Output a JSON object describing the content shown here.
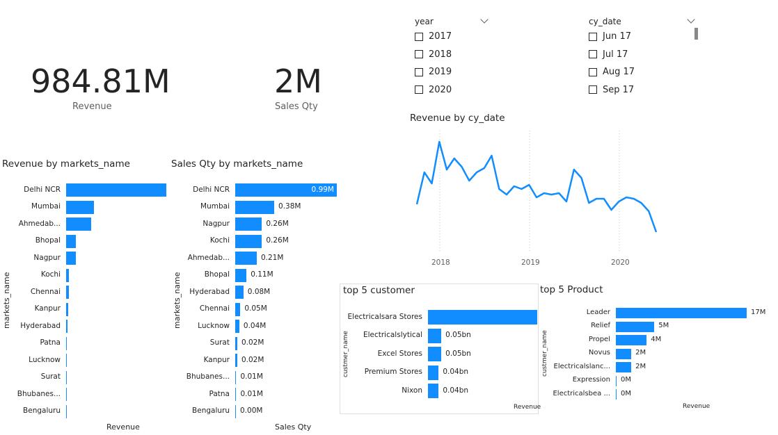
{
  "kpis": {
    "revenue": {
      "value": "984.81M",
      "label": "Revenue"
    },
    "sales_qty": {
      "value": "2M",
      "label": "Sales Qty"
    }
  },
  "slicers": {
    "year": {
      "title": "year",
      "items": [
        "2017",
        "2018",
        "2019",
        "2020"
      ]
    },
    "cy_date": {
      "title": "cy_date",
      "items": [
        "Jun 17",
        "Jul 17",
        "Aug 17",
        "Sep 17"
      ]
    }
  },
  "revenue_by_market": {
    "title": "Revenue by markets_name",
    "x_axis_title": "Revenue",
    "y_axis_title": "markets_name",
    "categories": [
      "Delhi NCR",
      "Mumbai",
      "Ahmedab...",
      "Bhopal",
      "Nagpur",
      "Kochi",
      "Chennai",
      "Kanpur",
      "Hyderabad",
      "Patna",
      "Lucknow",
      "Surat",
      "Bhubanes...",
      "Bengaluru"
    ],
    "values": [
      1.0,
      0.28,
      0.25,
      0.1,
      0.1,
      0.03,
      0.03,
      0.02,
      0.015,
      0.01,
      0.008,
      0.006,
      0.005,
      0.004
    ]
  },
  "sales_by_market": {
    "title": "Sales Qty by markets_name",
    "x_axis_title": "Sales Qty",
    "y_axis_title": "markets_name",
    "categories": [
      "Delhi NCR",
      "Mumbai",
      "Nagpur",
      "Kochi",
      "Ahmedab...",
      "Bhopal",
      "Hyderabad",
      "Chennai",
      "Lucknow",
      "Surat",
      "Kanpur",
      "Bhubanes...",
      "Patna",
      "Bengaluru"
    ],
    "values": [
      0.99,
      0.38,
      0.26,
      0.26,
      0.21,
      0.11,
      0.08,
      0.05,
      0.04,
      0.02,
      0.02,
      0.01,
      0.01,
      0.0
    ],
    "labels": [
      "0.99M",
      "0.38M",
      "0.26M",
      "0.26M",
      "0.21M",
      "0.11M",
      "0.08M",
      "0.05M",
      "0.04M",
      "0.02M",
      "0.02M",
      "0.01M",
      "0.01M",
      "0.00M"
    ]
  },
  "revenue_by_date": {
    "title": "Revenue by cy_date",
    "x_ticks": [
      "2018",
      "2019",
      "2020"
    ]
  },
  "top5_customer": {
    "title": "top 5 customer",
    "x_axis_title": "Revenue",
    "y_axis_title": "custmer_name",
    "categories": [
      "Electricalsara Stores",
      "Electricalslytical",
      "Excel Stores",
      "Premium Stores",
      "Nixon"
    ],
    "values": [
      0.41,
      0.05,
      0.05,
      0.04,
      0.04
    ],
    "labels": [
      "",
      "0.05bn",
      "0.05bn",
      "0.04bn",
      "0.04bn"
    ]
  },
  "top5_product": {
    "title": "top 5 Product",
    "x_axis_title": "Revenue",
    "y_axis_title": "custmer_name",
    "categories": [
      "Leader",
      "Relief",
      "Propel",
      "Novus",
      "Electricalslanc...",
      "Expression",
      "Electricalsbea ..."
    ],
    "values": [
      17,
      5,
      4,
      2,
      2,
      0,
      0
    ],
    "labels": [
      "17M",
      "5M",
      "4M",
      "2M",
      "2M",
      "0M",
      "0M"
    ]
  },
  "chart_data": [
    {
      "type": "bar",
      "title": "Revenue by markets_name",
      "xlabel": "Revenue",
      "ylabel": "markets_name",
      "categories": [
        "Delhi NCR",
        "Mumbai",
        "Ahmedab...",
        "Bhopal",
        "Nagpur",
        "Kochi",
        "Chennai",
        "Kanpur",
        "Hyderabad",
        "Patna",
        "Lucknow",
        "Surat",
        "Bhubanes...",
        "Bengaluru"
      ],
      "values": [
        1.0,
        0.28,
        0.25,
        0.1,
        0.1,
        0.03,
        0.03,
        0.02,
        0.015,
        0.01,
        0.008,
        0.006,
        0.005,
        0.004
      ]
    },
    {
      "type": "bar",
      "title": "Sales Qty by markets_name",
      "xlabel": "Sales Qty",
      "ylabel": "markets_name",
      "categories": [
        "Delhi NCR",
        "Mumbai",
        "Nagpur",
        "Kochi",
        "Ahmedab...",
        "Bhopal",
        "Hyderabad",
        "Chennai",
        "Lucknow",
        "Surat",
        "Kanpur",
        "Bhubanes...",
        "Patna",
        "Bengaluru"
      ],
      "values": [
        0.99,
        0.38,
        0.26,
        0.26,
        0.21,
        0.11,
        0.08,
        0.05,
        0.04,
        0.02,
        0.02,
        0.01,
        0.01,
        0.0
      ]
    },
    {
      "type": "line",
      "title": "Revenue by cy_date",
      "x": [
        "2017-06",
        "2017-07",
        "2017-08",
        "2017-09",
        "2017-10",
        "2017-11",
        "2017-12",
        "2018-01",
        "2018-02",
        "2018-03",
        "2018-04",
        "2018-05",
        "2018-06",
        "2018-07",
        "2018-08",
        "2018-09",
        "2018-10",
        "2018-11",
        "2018-12",
        "2019-01",
        "2019-02",
        "2019-03",
        "2019-04",
        "2019-05",
        "2019-06",
        "2019-07",
        "2019-08",
        "2019-09",
        "2019-10",
        "2019-11",
        "2019-12",
        "2020-01",
        "2020-02",
        "2020-03",
        "2020-04",
        "2020-05",
        "2020-06"
      ],
      "y": [
        27,
        50,
        42,
        72,
        52,
        60,
        54,
        44,
        50,
        53,
        62,
        38,
        34,
        40,
        38,
        41,
        32,
        35,
        34,
        35,
        29,
        52,
        46,
        28,
        31,
        31,
        23,
        29,
        32,
        31,
        28,
        22,
        7
      ],
      "x_ticks": [
        "2018",
        "2019",
        "2020"
      ]
    },
    {
      "type": "bar",
      "title": "top 5 customer",
      "xlabel": "Revenue",
      "ylabel": "custmer_name",
      "categories": [
        "Electricalsara Stores",
        "Electricalslytical",
        "Excel Stores",
        "Premium Stores",
        "Nixon"
      ],
      "values": [
        0.41,
        0.05,
        0.05,
        0.04,
        0.04
      ]
    },
    {
      "type": "bar",
      "title": "top 5 Product",
      "xlabel": "Revenue",
      "ylabel": "custmer_name",
      "categories": [
        "Leader",
        "Relief",
        "Propel",
        "Novus",
        "Electricalslanc...",
        "Expression",
        "Electricalsbea ..."
      ],
      "values": [
        17,
        5,
        4,
        2,
        2,
        0,
        0
      ]
    }
  ]
}
